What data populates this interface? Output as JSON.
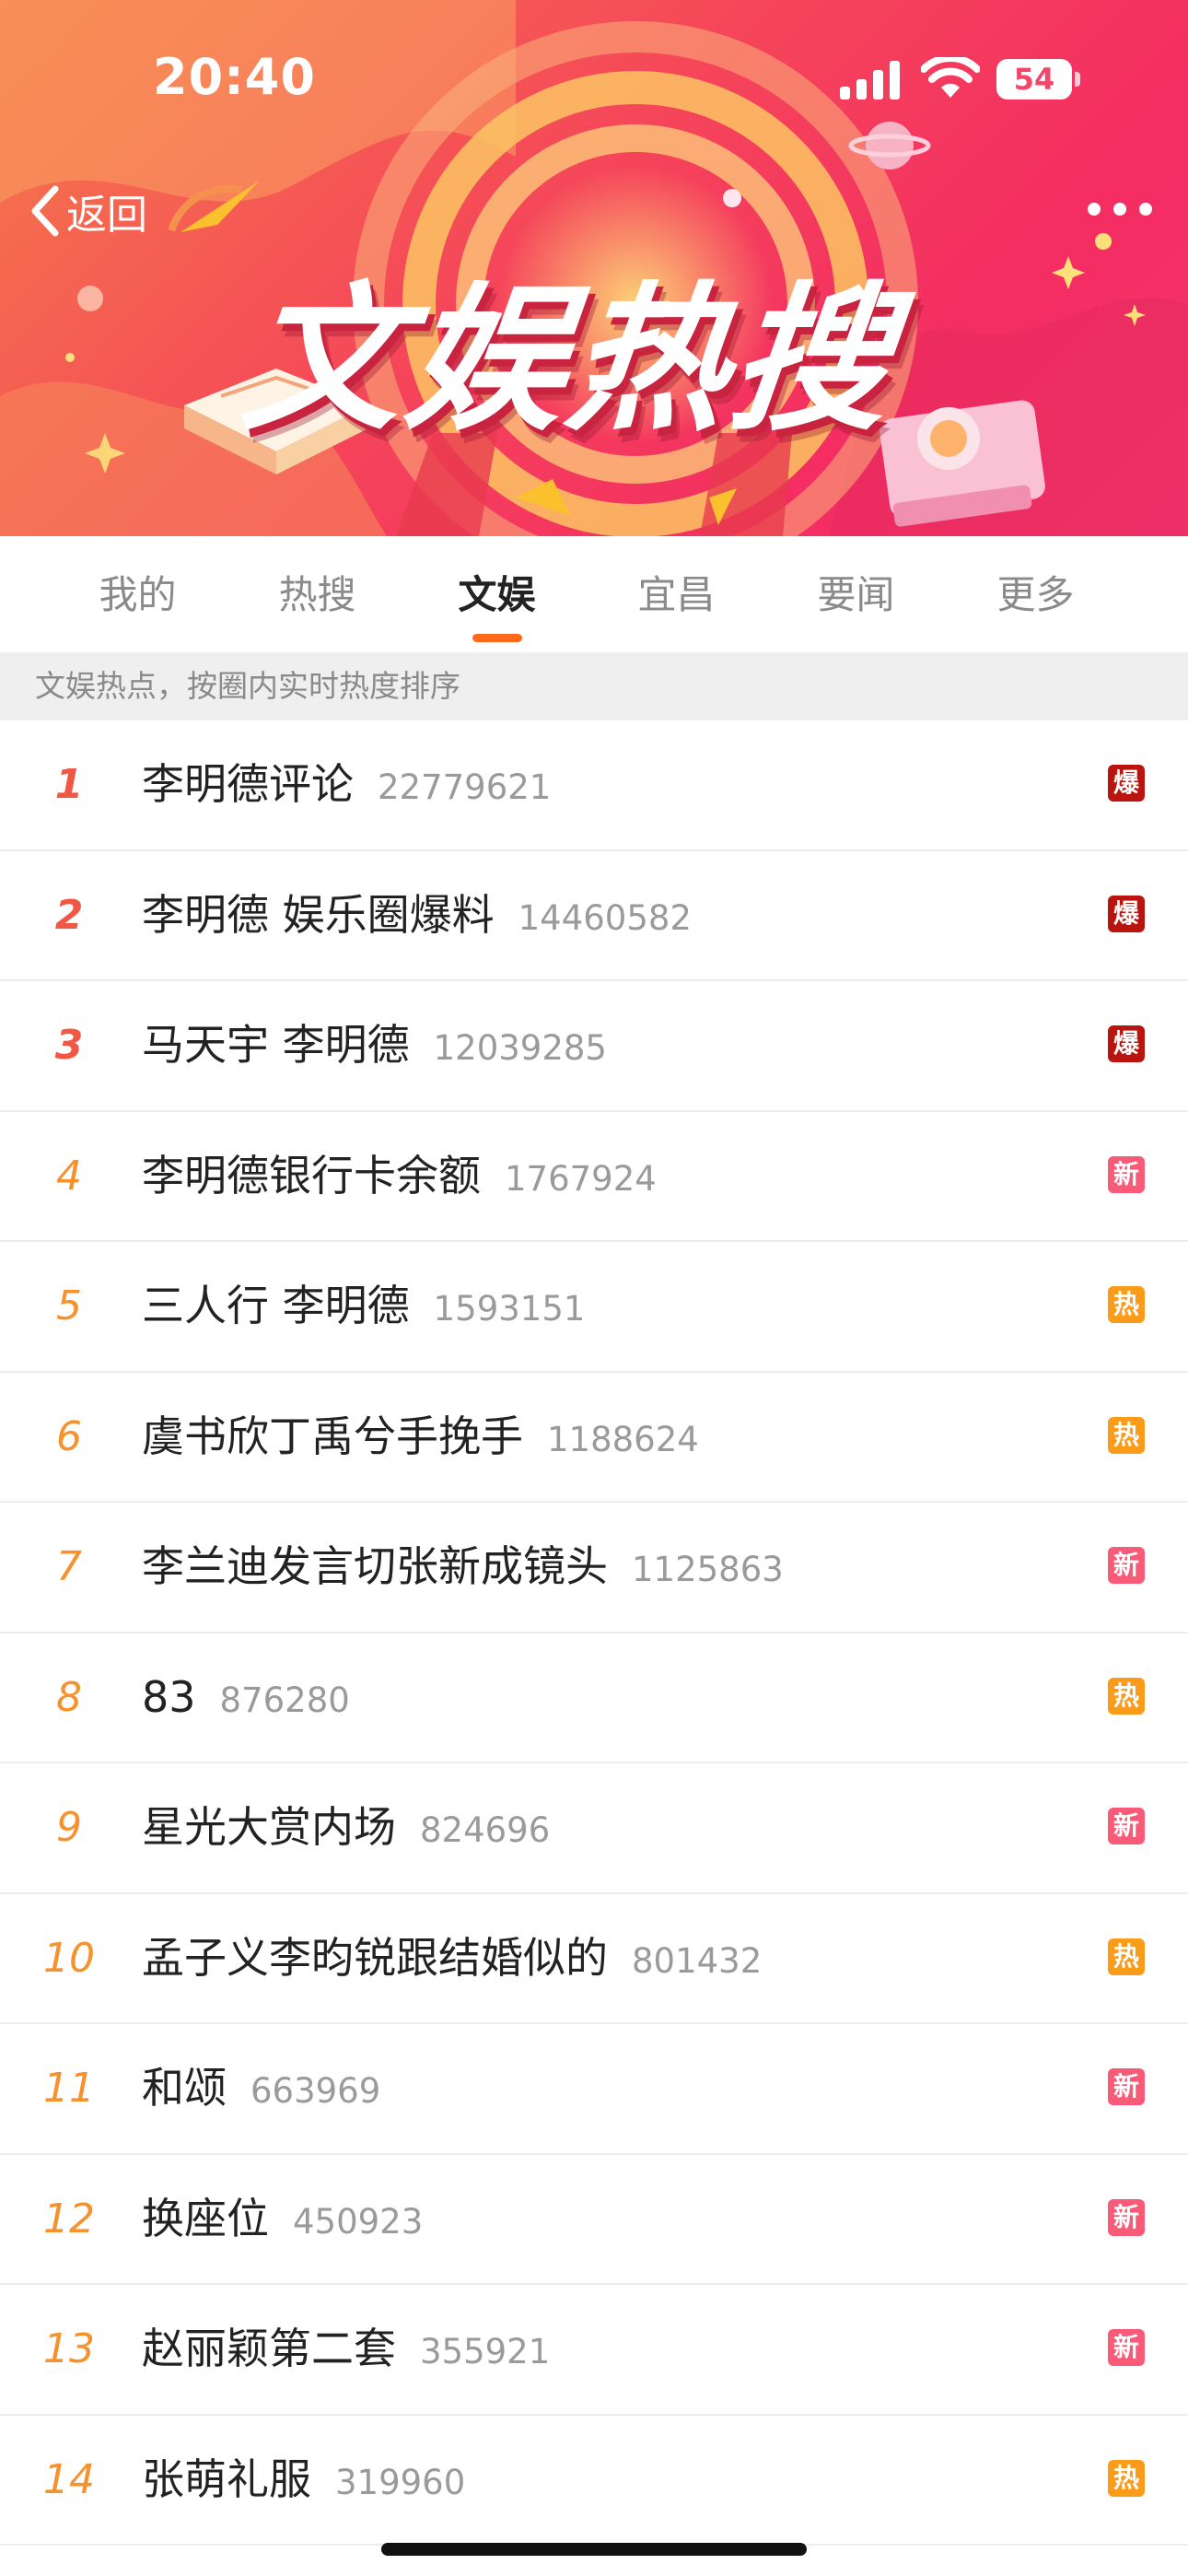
{
  "status_bar": {
    "time": "20:40",
    "battery": "54",
    "icons": [
      "signal-icon",
      "wifi-icon",
      "battery-icon"
    ]
  },
  "header": {
    "back_label": "返回",
    "banner_title": "文娱热搜",
    "icons": [
      "chevron-left-icon",
      "more-dots-icon"
    ]
  },
  "tabs": [
    {
      "label": "我的",
      "active": false
    },
    {
      "label": "热搜",
      "active": false
    },
    {
      "label": "文娱",
      "active": true
    },
    {
      "label": "宜昌",
      "active": false
    },
    {
      "label": "要闻",
      "active": false
    },
    {
      "label": "更多",
      "active": false
    }
  ],
  "subheader": "文娱热点，按圈内实时热度排序",
  "colors": {
    "accent": "#ff6a1a",
    "rank_top": "#f05744",
    "rank_other": "#f7912b",
    "badge_bao": "#b9150e",
    "badge_xin": "#f85a78",
    "badge_re": "#fa9c19"
  },
  "list": [
    {
      "rank": "1",
      "keyword": "李明德评论",
      "count": "22779621",
      "badge": "爆",
      "badge_type": "bao"
    },
    {
      "rank": "2",
      "keyword": "李明德 娱乐圈爆料",
      "count": "14460582",
      "badge": "爆",
      "badge_type": "bao"
    },
    {
      "rank": "3",
      "keyword": "马天宇 李明德",
      "count": "12039285",
      "badge": "爆",
      "badge_type": "bao"
    },
    {
      "rank": "4",
      "keyword": "李明德银行卡余额",
      "count": "1767924",
      "badge": "新",
      "badge_type": "xin"
    },
    {
      "rank": "5",
      "keyword": "三人行 李明德",
      "count": "1593151",
      "badge": "热",
      "badge_type": "re"
    },
    {
      "rank": "6",
      "keyword": "虞书欣丁禹兮手挽手",
      "count": "1188624",
      "badge": "热",
      "badge_type": "re"
    },
    {
      "rank": "7",
      "keyword": "李兰迪发言切张新成镜头",
      "count": "1125863",
      "badge": "新",
      "badge_type": "xin"
    },
    {
      "rank": "8",
      "keyword": "83",
      "count": "876280",
      "badge": "热",
      "badge_type": "re"
    },
    {
      "rank": "9",
      "keyword": "星光大赏内场",
      "count": "824696",
      "badge": "新",
      "badge_type": "xin"
    },
    {
      "rank": "10",
      "keyword": "孟子义李昀锐跟结婚似的",
      "count": "801432",
      "badge": "热",
      "badge_type": "re"
    },
    {
      "rank": "11",
      "keyword": "和颂",
      "count": "663969",
      "badge": "新",
      "badge_type": "xin"
    },
    {
      "rank": "12",
      "keyword": "换座位",
      "count": "450923",
      "badge": "新",
      "badge_type": "xin"
    },
    {
      "rank": "13",
      "keyword": "赵丽颖第二套",
      "count": "355921",
      "badge": "新",
      "badge_type": "xin"
    },
    {
      "rank": "14",
      "keyword": "张萌礼服",
      "count": "319960",
      "badge": "热",
      "badge_type": "re"
    }
  ]
}
